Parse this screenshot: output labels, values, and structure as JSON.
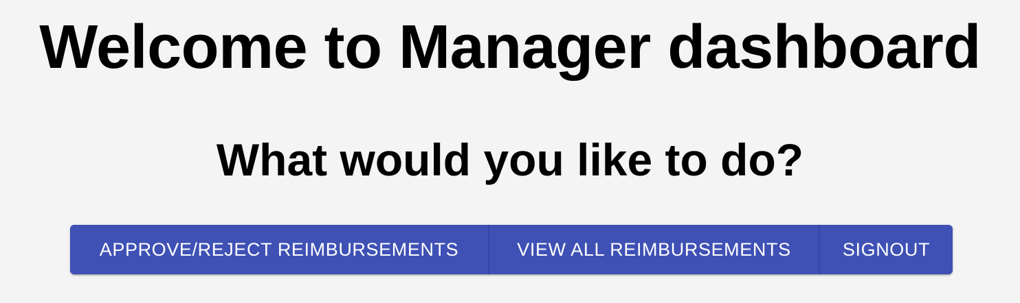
{
  "header": {
    "title": "Welcome to Manager dashboard",
    "subtitle": "What would you like to do?"
  },
  "actions": {
    "approve_reject_label": "APPROVE/REJECT REIMBURSEMENTS",
    "view_all_label": "VIEW ALL REIMBURSEMENTS",
    "signout_label": "SIGNOUT"
  },
  "colors": {
    "background": "#f4f4f4",
    "button_primary": "#3f51b5",
    "button_text": "#ffffff",
    "heading_text": "#000000"
  }
}
